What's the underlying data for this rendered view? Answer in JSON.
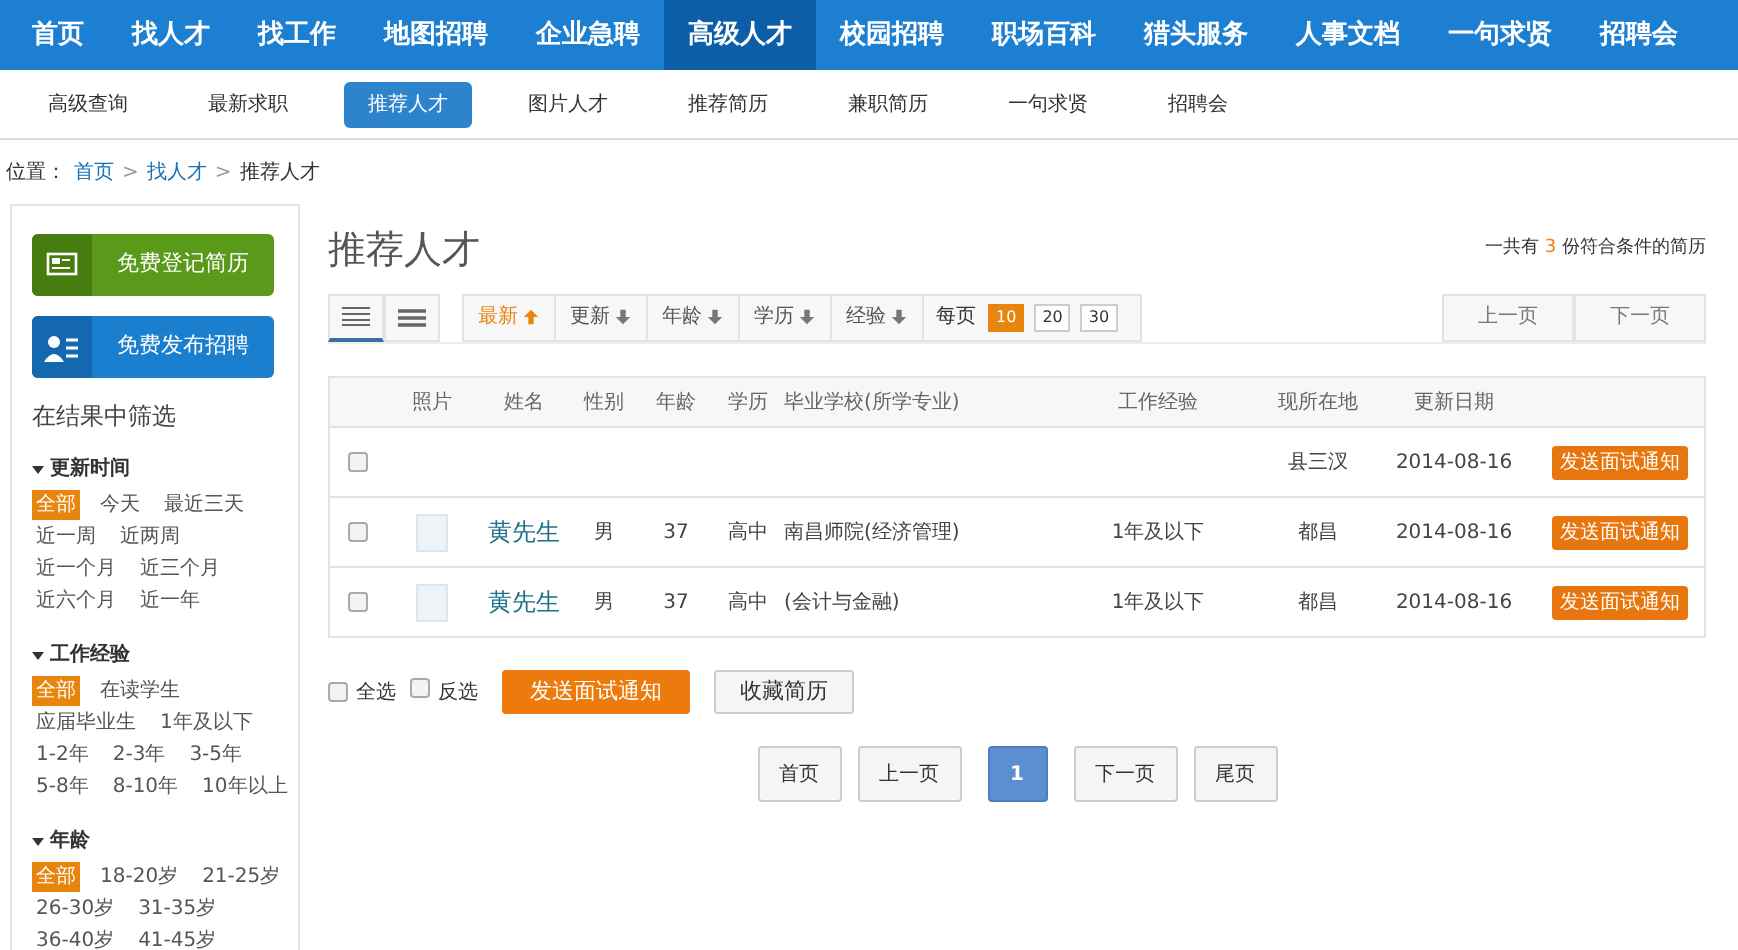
{
  "nav": [
    {
      "label": "首页",
      "selected": false
    },
    {
      "label": "找人才",
      "selected": false
    },
    {
      "label": "找工作",
      "selected": false
    },
    {
      "label": "地图招聘",
      "selected": false
    },
    {
      "label": "企业急聘",
      "selected": false
    },
    {
      "label": "高级人才",
      "selected": true
    },
    {
      "label": "校园招聘",
      "selected": false
    },
    {
      "label": "职场百科",
      "selected": false
    },
    {
      "label": "猎头服务",
      "selected": false
    },
    {
      "label": "人事文档",
      "selected": false
    },
    {
      "label": "一句求贤",
      "selected": false
    },
    {
      "label": "招聘会",
      "selected": false
    }
  ],
  "subnav": [
    {
      "label": "高级查询",
      "selected": false
    },
    {
      "label": "最新求职",
      "selected": false
    },
    {
      "label": "推荐人才",
      "selected": true
    },
    {
      "label": "图片人才",
      "selected": false
    },
    {
      "label": "推荐简历",
      "selected": false
    },
    {
      "label": "兼职简历",
      "selected": false
    },
    {
      "label": "一句求贤",
      "selected": false
    },
    {
      "label": "招聘会",
      "selected": false
    }
  ],
  "breadcrumb": {
    "prefix": "位置：",
    "separator": ">",
    "links": [
      "首页",
      "找人才"
    ],
    "current": "推荐人才"
  },
  "sidebar": {
    "actions": [
      {
        "kind": "resume",
        "label": "免费登记简历"
      },
      {
        "kind": "post",
        "label": "免费发布招聘"
      }
    ],
    "filter_title": "在结果中筛选",
    "groups": [
      {
        "title": "更新时间",
        "rows": [
          [
            {
              "label": "全部",
              "selected": true
            },
            {
              "label": "今天",
              "selected": false
            },
            {
              "label": "最近三天",
              "selected": false
            }
          ],
          [
            {
              "label": "近一周",
              "selected": false
            },
            {
              "label": "近两周",
              "selected": false
            }
          ],
          [
            {
              "label": "近一个月",
              "selected": false
            },
            {
              "label": "近三个月",
              "selected": false
            }
          ],
          [
            {
              "label": "近六个月",
              "selected": false
            },
            {
              "label": "近一年",
              "selected": false
            }
          ]
        ]
      },
      {
        "title": "工作经验",
        "rows": [
          [
            {
              "label": "全部",
              "selected": true
            },
            {
              "label": "在读学生",
              "selected": false
            }
          ],
          [
            {
              "label": "应届毕业生",
              "selected": false
            },
            {
              "label": "1年及以下",
              "selected": false
            }
          ],
          [
            {
              "label": "1-2年",
              "selected": false
            },
            {
              "label": "2-3年",
              "selected": false
            },
            {
              "label": "3-5年",
              "selected": false
            }
          ],
          [
            {
              "label": "5-8年",
              "selected": false
            },
            {
              "label": "8-10年",
              "selected": false
            },
            {
              "label": "10年以上",
              "selected": false
            }
          ]
        ]
      },
      {
        "title": "年龄",
        "rows": [
          [
            {
              "label": "全部",
              "selected": true
            },
            {
              "label": "18-20岁",
              "selected": false
            },
            {
              "label": "21-25岁",
              "selected": false
            }
          ],
          [
            {
              "label": "26-30岁",
              "selected": false
            },
            {
              "label": "31-35岁",
              "selected": false
            }
          ],
          [
            {
              "label": "36-40岁",
              "selected": false
            },
            {
              "label": "41-45岁",
              "selected": false
            }
          ]
        ]
      }
    ]
  },
  "main": {
    "title": "推荐人才",
    "total": {
      "before": "一共有",
      "count": "3",
      "after": "份符合条件的简历"
    },
    "views": [
      {
        "kind": "list",
        "selected": true
      },
      {
        "kind": "compact",
        "selected": false
      }
    ],
    "sorts": [
      {
        "label": "最新",
        "selected": true
      },
      {
        "label": "更新",
        "selected": false
      },
      {
        "label": "年龄",
        "selected": false
      },
      {
        "label": "学历",
        "selected": false
      },
      {
        "label": "经验",
        "selected": false
      }
    ],
    "per_page_label": "每页",
    "per_page": [
      {
        "label": "10",
        "selected": true
      },
      {
        "label": "20",
        "selected": false
      },
      {
        "label": "30",
        "selected": false
      }
    ],
    "prev": "上一页",
    "next": "下一页",
    "columns": [
      "照片",
      "姓名",
      "性别",
      "年龄",
      "学历",
      "毕业学校(所学专业)",
      "工作经验",
      "现所在地",
      "更新日期"
    ],
    "rows": [
      {
        "checked": false,
        "photo": false,
        "location": "县三汊",
        "date": "2014-08-16",
        "action": "发送面试通知"
      },
      {
        "checked": false,
        "photo": true,
        "name": "黄先生",
        "gender": "男",
        "age": "37",
        "education": "高中",
        "school": "南昌师院(经济管理)",
        "experience": "1年及以下",
        "location": "都昌",
        "date": "2014-08-16",
        "action": "发送面试通知"
      },
      {
        "checked": false,
        "photo": true,
        "name": "黄先生",
        "gender": "男",
        "age": "37",
        "education": "高中",
        "school": "(会计与金融)",
        "experience": "1年及以下",
        "location": "都昌",
        "date": "2014-08-16",
        "action": "发送面试通知"
      }
    ],
    "select_all": {
      "label": "全选",
      "checked": false
    },
    "invert": {
      "label": "反选",
      "checked": false
    },
    "bulk_send": "发送面试通知",
    "bulk_save": "收藏简历",
    "pager": [
      {
        "label": "首页",
        "selected": false
      },
      {
        "label": "上一页",
        "selected": false
      },
      {
        "label": "1",
        "selected": true
      },
      {
        "label": "下一页",
        "selected": false
      },
      {
        "label": "尾页",
        "selected": false
      }
    ]
  }
}
